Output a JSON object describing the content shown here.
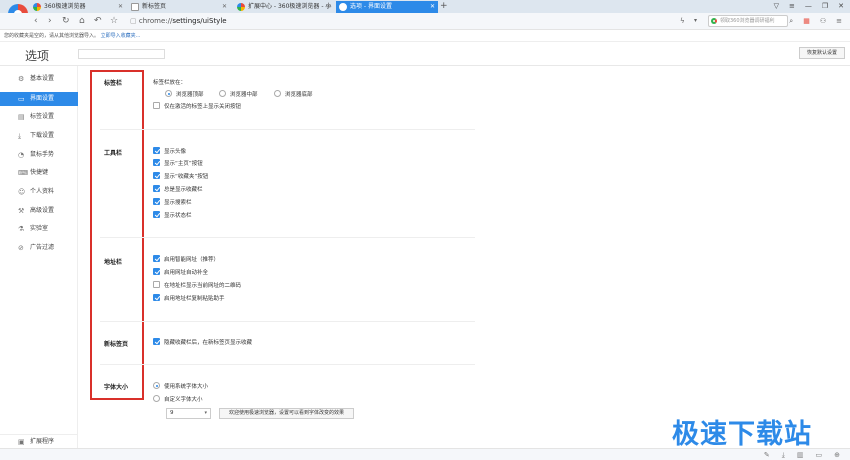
{
  "tabs": [
    {
      "label": "360极速浏览器",
      "icon": "360-logo-icon"
    },
    {
      "label": "新标签页",
      "icon": "document-icon"
    },
    {
      "label": "扩展中心 - 360极速浏览器 - 小",
      "icon": "360-logo-icon"
    },
    {
      "label": "选项 - 界面设置",
      "icon": "gear-icon",
      "active": true
    }
  ],
  "address": {
    "scheme": "chrome://",
    "path": "settings/uiStyle"
  },
  "search": {
    "placeholder": "领取360浏览器调研福利"
  },
  "favbar": {
    "text": "您的收藏夹是空的，请从其他浏览器导入。",
    "link": "立即导入收藏夹..."
  },
  "header": {
    "title": "选项",
    "restore_label": "恢复默认设置"
  },
  "sidebar": {
    "items": [
      {
        "label": "基本设置",
        "icon": "gear-icon"
      },
      {
        "label": "界面设置",
        "icon": "monitor-icon",
        "active": true
      },
      {
        "label": "标签设置",
        "icon": "tab-icon"
      },
      {
        "label": "下载设置",
        "icon": "download-icon"
      },
      {
        "label": "鼠标手势",
        "icon": "mouse-icon"
      },
      {
        "label": "快捷键",
        "icon": "keyboard-icon"
      },
      {
        "label": "个人资料",
        "icon": "user-icon"
      },
      {
        "label": "高级设置",
        "icon": "wrench-icon"
      },
      {
        "label": "实验室",
        "icon": "flask-icon"
      },
      {
        "label": "广告过滤",
        "icon": "block-icon"
      }
    ],
    "extensions": "扩展程序"
  },
  "sections": {
    "tabbar": {
      "label": "标签栏",
      "position_label": "标签栏放在：",
      "positions": [
        "浏览器顶部",
        "浏览器中部",
        "浏览器底部"
      ],
      "close_only_active": "仅在激活的标签上显示关闭按钮"
    },
    "toolbar": {
      "label": "工具栏",
      "options": [
        "显示头像",
        "显示“主页”按钮",
        "显示“收藏夹”按钮",
        "总是显示收藏栏",
        "显示搜索栏",
        "显示状态栏"
      ]
    },
    "addressbar": {
      "label": "地址栏",
      "options": [
        "启用智能网址（推荐）",
        "启用网址自动补全",
        "在地址栏显示当前网址的二维码",
        "启用地址栏复制粘贴助手"
      ]
    },
    "newtab": {
      "label": "新标签页",
      "option": "隐藏收藏栏后，在新标签页显示收藏"
    },
    "fontsize": {
      "label": "字体大小",
      "options": [
        "使用系统字体大小",
        "自定义字体大小"
      ],
      "value": "9",
      "hint": "欢迎使用极速浏览器，设置可以看到字体改变的效果"
    }
  },
  "watermark": "极速下载站",
  "colors": {
    "accent": "#2d8ae8",
    "highlight": "#d9302a"
  }
}
